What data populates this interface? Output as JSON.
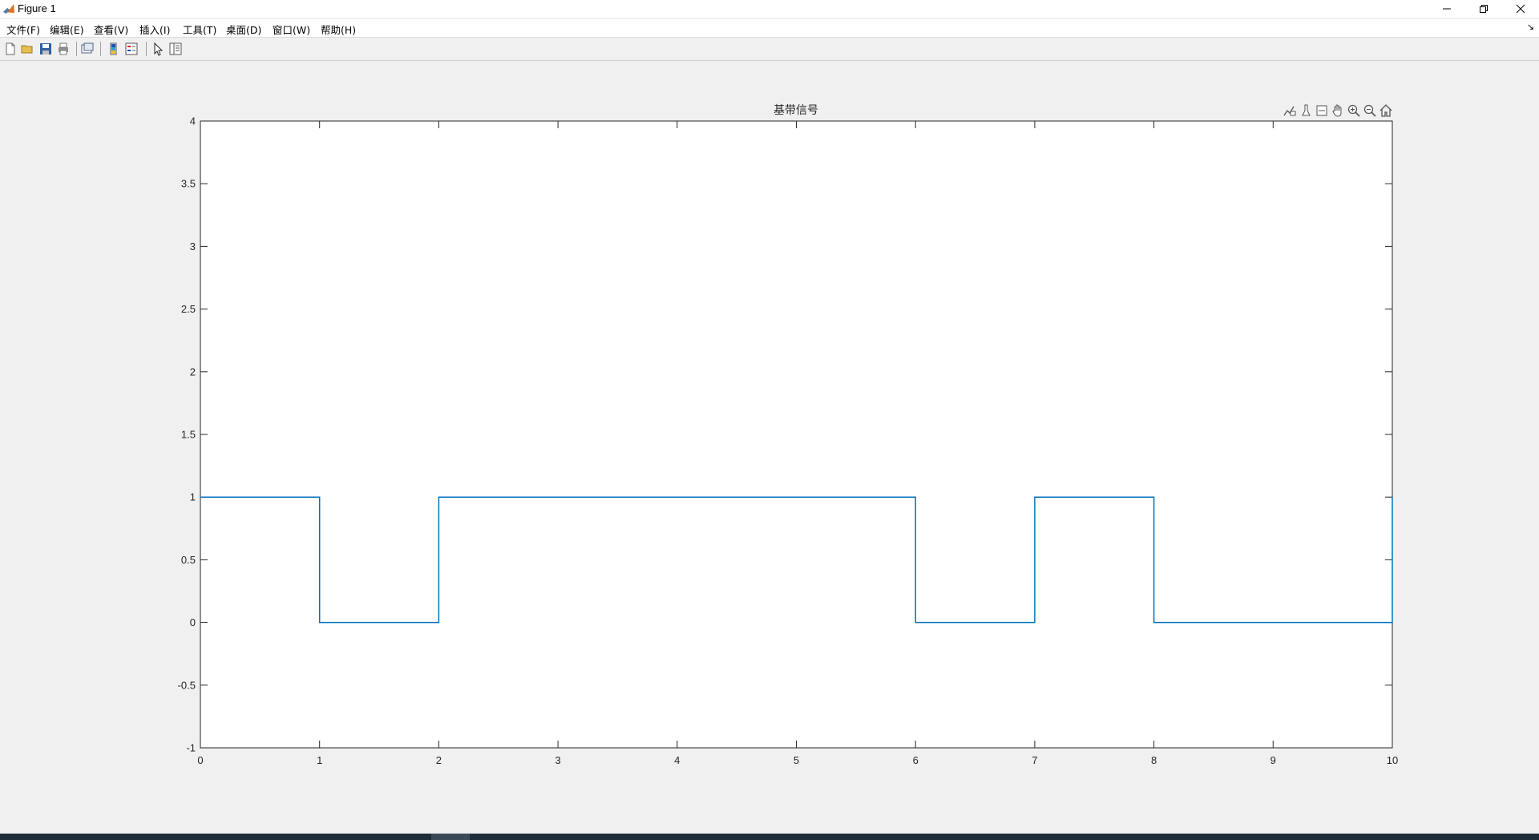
{
  "window": {
    "title": "Figure 1",
    "icons": {
      "app": "matlab-icon",
      "minimize": "minimize-icon",
      "restore": "restore-icon",
      "close": "close-icon"
    }
  },
  "menubar": {
    "items": [
      "文件(F)",
      "编辑(E)",
      "查看(V)",
      "插入(I)",
      "工具(T)",
      "桌面(D)",
      "窗口(W)",
      "帮助(H)"
    ],
    "corner_icon": "dock-arrow-icon"
  },
  "toolbar": {
    "buttons": [
      "new-figure-icon",
      "open-icon",
      "save-icon",
      "print-icon",
      "link-plot-icon",
      "insert-colorbar-icon",
      "insert-legend-icon",
      "edit-plot-icon",
      "property-inspector-icon"
    ]
  },
  "axes_toolbar": {
    "buttons": [
      "data-tips-icon",
      "brush-icon",
      "restore-view-toggle-icon",
      "pan-icon",
      "zoom-in-icon",
      "zoom-out-icon",
      "home-icon"
    ]
  },
  "chart_data": {
    "type": "line",
    "title": "基带信号",
    "xlabel": "",
    "ylabel": "",
    "xlim": [
      0,
      10
    ],
    "ylim": [
      -1,
      4
    ],
    "x_ticks": [
      "0",
      "1",
      "2",
      "3",
      "4",
      "5",
      "6",
      "7",
      "8",
      "9",
      "10"
    ],
    "y_ticks": [
      "-1",
      "-0.5",
      "0",
      "0.5",
      "1",
      "1.5",
      "2",
      "2.5",
      "3",
      "3.5",
      "4"
    ],
    "grid": false,
    "series": [
      {
        "color": "#0072bd",
        "step_values": [
          1,
          0,
          1,
          1,
          1,
          1,
          0,
          1,
          0,
          0
        ],
        "x": [
          0,
          1,
          1,
          2,
          2,
          6,
          6,
          7,
          7,
          8,
          8,
          10,
          10
        ],
        "y": [
          1,
          1,
          0,
          0,
          1,
          1,
          0,
          0,
          1,
          1,
          0,
          0,
          1
        ]
      }
    ]
  }
}
